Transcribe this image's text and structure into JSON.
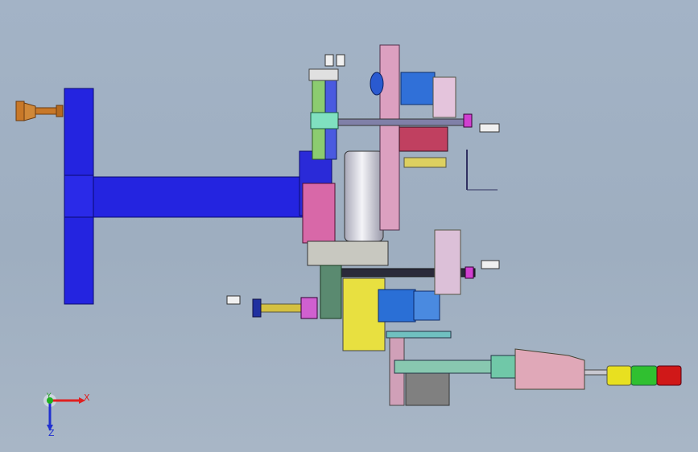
{
  "viewport": {
    "background_top": "#a3b3c6",
    "background_bottom": "#a8b6c6"
  },
  "triad": {
    "x_label": "X",
    "y_label": "Y",
    "z_label": "Z",
    "x_color": "#e02020",
    "y_color": "#20b020",
    "z_color": "#2030d0"
  },
  "model": {
    "frame_color": "#2424e0",
    "roller_color": "#d8d8e0",
    "arm_color": "#dca0c0",
    "motor_color": "#2a6fd6",
    "housing_color": "#e8e040",
    "tower_light_colors": [
      "#e8e020",
      "#30c030",
      "#d01818"
    ]
  }
}
